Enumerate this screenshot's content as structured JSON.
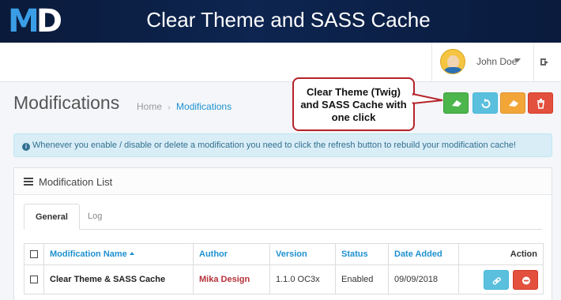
{
  "banner": {
    "logo_m": "M",
    "logo_d": "D",
    "title": "Clear Theme and SASS Cache"
  },
  "header": {
    "user_name": "John Doe"
  },
  "page": {
    "title": "Modifications",
    "breadcrumb": [
      "Home",
      "Modifications"
    ],
    "breadcrumb_sep": "›"
  },
  "toolbar": {
    "buttons": [
      {
        "name": "clear-theme-sass-button",
        "icon": "eraser-icon",
        "color": "#4cb64c"
      },
      {
        "name": "refresh-button",
        "icon": "refresh-icon",
        "color": "#5bc0de"
      },
      {
        "name": "clear-button",
        "icon": "eraser-icon",
        "color": "#f3a638"
      },
      {
        "name": "delete-button",
        "icon": "trash-icon",
        "color": "#e3503e"
      }
    ]
  },
  "callout": {
    "lines": [
      "Clear Theme (Twig)",
      "and SASS Cache with",
      "one click"
    ]
  },
  "alert": {
    "text": "Whenever you enable / disable or delete a modification you need to click the refresh button to rebuild your modification cache!"
  },
  "panel": {
    "title": "Modification List",
    "tabs": [
      "General",
      "Log"
    ]
  },
  "table": {
    "headers": [
      "Modification Name",
      "Author",
      "Version",
      "Status",
      "Date Added",
      "Action"
    ],
    "rows": [
      {
        "name": "Clear Theme & SASS Cache",
        "author": "Mika Design",
        "version": "1.1.0 OC3x",
        "status": "Enabled",
        "date_added": "09/09/2018"
      }
    ]
  },
  "colors": {
    "accent": "#1e91cf",
    "author": "#b5323a",
    "callout_border": "#b5232b"
  }
}
